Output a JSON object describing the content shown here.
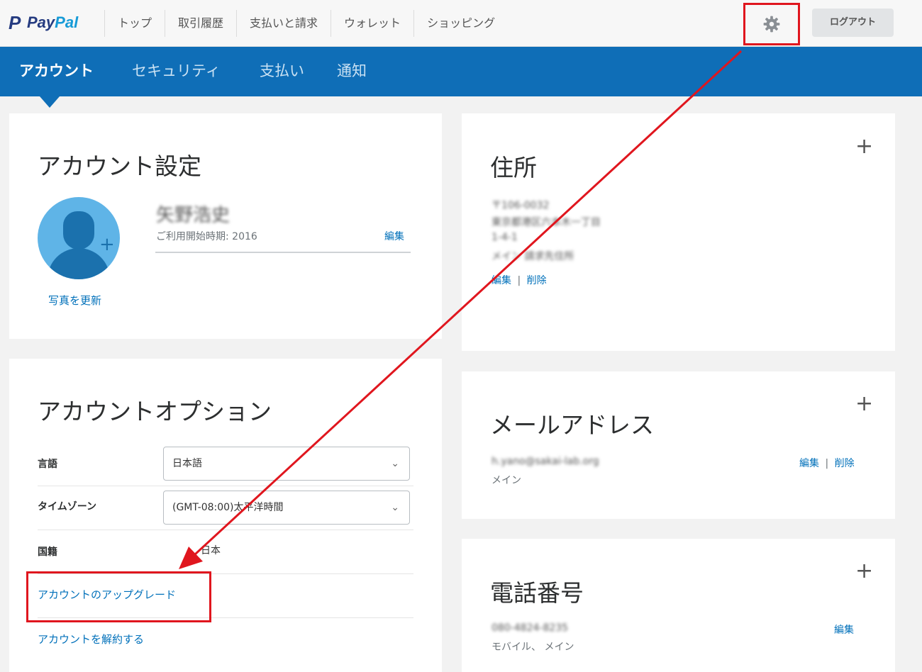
{
  "topbar": {
    "logo_p": "P",
    "logo_pay": "Pay",
    "logo_pal": "Pal",
    "nav": [
      "トップ",
      "取引履歴",
      "支払いと請求",
      "ウォレット",
      "ショッピング"
    ],
    "settings_icon": "gear-icon",
    "logout_label": "ログアウト"
  },
  "subnav": {
    "tabs": [
      "アカウント",
      "セキュリティ",
      "支払い",
      "通知"
    ],
    "active": "アカウント"
  },
  "account_settings": {
    "title": "アカウント設定",
    "name": "矢野浩史",
    "since": "ご利用開始時期: 2016",
    "edit_label": "編集",
    "update_photo_label": "写真を更新"
  },
  "address": {
    "title": "住所",
    "plus": "+",
    "lines": [
      "〒106-0032",
      "東京都港区六本木一丁目",
      "1-4-1",
      "メイン 請求先住所"
    ],
    "edit_label": "編集",
    "separator": "|",
    "delete_label": "削除"
  },
  "account_options": {
    "title": "アカウントオプション",
    "language_label": "言語",
    "language_value": "日本語",
    "timezone_label": "タイムゾーン",
    "timezone_value": "(GMT-08:00)太平洋時間",
    "nationality_label": "国籍",
    "nationality_value": "日本",
    "upgrade_label": "アカウントのアップグレード",
    "close_label": "アカウントを解約する"
  },
  "email": {
    "title": "メールアドレス",
    "plus": "+",
    "address": "h.yano@sakai-lab.org",
    "type": "メイン",
    "edit_label": "編集",
    "separator": "|",
    "delete_label": "削除"
  },
  "phone": {
    "title": "電話番号",
    "plus": "+",
    "number": "080-4824-8235",
    "type": "モバイル、 メイン",
    "edit_label": "編集"
  },
  "colors": {
    "brand_blue": "#0f6eb7",
    "link_blue": "#0070ba",
    "annotation_red": "#e0161e"
  }
}
